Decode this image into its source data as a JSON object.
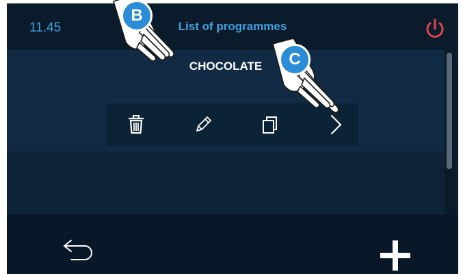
{
  "status": {
    "time": "11.45",
    "title": "List of programmes"
  },
  "colors": {
    "accent": "#3fa2de",
    "power": "#e0464a",
    "badge": "#2a8dd6"
  },
  "programme": {
    "name": "CHOCOLATE"
  },
  "actions": [
    {
      "icon": "trash-icon"
    },
    {
      "icon": "pencil-icon"
    },
    {
      "icon": "copy-icon"
    },
    {
      "icon": "chevron-right-icon"
    }
  ],
  "bottom": {
    "back_icon": "back-arrow-icon",
    "add_icon": "plus-icon"
  },
  "callouts": {
    "b": "B",
    "c": "C"
  }
}
